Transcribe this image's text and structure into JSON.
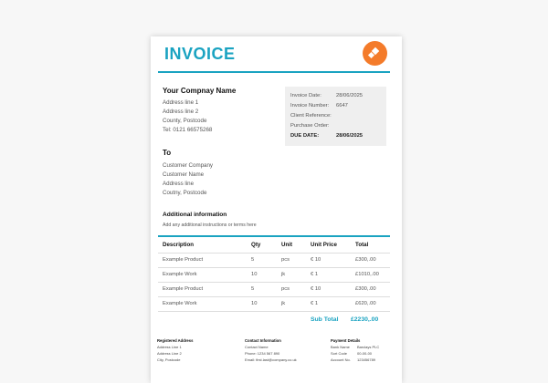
{
  "invoice": {
    "title": "INVOICE",
    "company_name": "Your Compnay Name",
    "address": [
      "Address line 1",
      "Address line 2",
      "County, Postcode",
      "Tel: 0121 66575268"
    ],
    "info": {
      "date_label": "Invoice Date:",
      "date_value": "28/06/2025",
      "number_label": "Invoice Number:",
      "number_value": "6647",
      "client_ref_label": "Client Reference:",
      "po_label": "Purchase Order:",
      "due_label": "DUE DATE:",
      "due_value": "28/06/2025"
    },
    "to": {
      "heading": "To",
      "lines": [
        "Customer Company",
        "Customer Name",
        "Address line",
        "Coutny, Postcode"
      ]
    },
    "additional": {
      "heading": "Additional information",
      "text": "Add any additional instructions or terms here"
    },
    "table": {
      "headers": [
        "Description",
        "Qty",
        "Unit",
        "Unit Price",
        "Total"
      ],
      "rows": [
        [
          "Example Product",
          "5",
          "pcs",
          "€ 10",
          "£300,.00"
        ],
        [
          "Example Work",
          "10",
          "jk",
          "€ 1",
          "£1010,.00"
        ],
        [
          "Example Product",
          "5",
          "pcs",
          "€ 10",
          "£300,.00"
        ],
        [
          "Example Work",
          "10",
          "jk",
          "€ 1",
          "£620,.00"
        ]
      ]
    },
    "subtotal_label": "Sub Total",
    "subtotal_value": "£2230,.00",
    "footer": {
      "registered_heading": "Registered Address",
      "registered_lines": [
        "Address Line 1",
        "Address Line 2",
        "City, Postcode"
      ],
      "contact_heading": "Contact Information",
      "contact_lines": [
        "Contact Name",
        "Phone: 1234 567 890",
        "Email: first.last@company.co.uk"
      ],
      "payment_heading": "Payment Details",
      "payment_rows": [
        [
          "Bank Name",
          "Barclays PLC"
        ],
        [
          "Sort Code",
          "00-00-00"
        ],
        [
          "Account No.",
          "123456789"
        ]
      ]
    }
  },
  "colors": {
    "accent": "#1aa3c1",
    "logo": "#f47b2a",
    "info_bg": "#efefef"
  },
  "icons": {
    "logo": "orange-circle-logo-icon"
  }
}
